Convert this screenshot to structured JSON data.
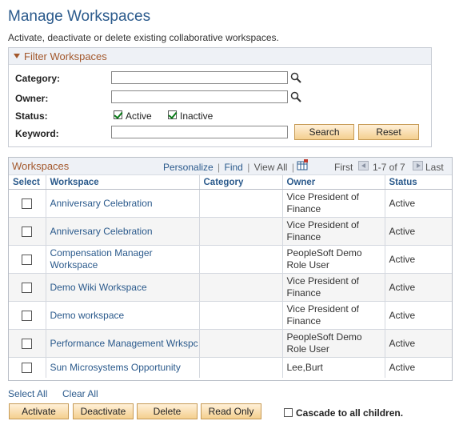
{
  "page": {
    "title": "Manage Workspaces",
    "subtitle": "Activate, deactivate or delete existing collaborative workspaces."
  },
  "filter": {
    "header": "Filter Workspaces",
    "category_label": "Category:",
    "category_value": "",
    "owner_label": "Owner:",
    "owner_value": "",
    "status_label": "Status:",
    "status_active_label": "Active",
    "status_active_checked": true,
    "status_inactive_label": "Inactive",
    "status_inactive_checked": true,
    "keyword_label": "Keyword:",
    "keyword_value": "",
    "search_label": "Search",
    "reset_label": "Reset"
  },
  "grid": {
    "title": "Workspaces",
    "personalize": "Personalize",
    "find": "Find",
    "view_all": "View All",
    "first": "First",
    "range": "1-7 of 7",
    "last": "Last",
    "columns": [
      "Select",
      "Workspace",
      "Category",
      "Owner",
      "Status"
    ],
    "rows": [
      {
        "workspace": "Anniversary Celebration",
        "category": "",
        "owner": "Vice President of Finance",
        "status": "Active"
      },
      {
        "workspace": "Anniversary Celebration",
        "category": "",
        "owner": "Vice President of Finance",
        "status": "Active"
      },
      {
        "workspace": "Compensation Manager Workspace",
        "category": "",
        "owner": "PeopleSoft Demo Role User",
        "status": "Active"
      },
      {
        "workspace": "Demo Wiki Workspace",
        "category": "",
        "owner": "Vice President of Finance",
        "status": "Active"
      },
      {
        "workspace": "Demo workspace",
        "category": "",
        "owner": "Vice President of Finance",
        "status": "Active"
      },
      {
        "workspace": "Performance Management Wrkspc",
        "category": "",
        "owner": "PeopleSoft Demo Role User",
        "status": "Active"
      },
      {
        "workspace": "Sun Microsystems Opportunity",
        "category": "",
        "owner": "Lee,Burt",
        "status": "Active"
      }
    ]
  },
  "bottom": {
    "select_all": "Select All",
    "clear_all": "Clear All",
    "activate": "Activate",
    "deactivate": "Deactivate",
    "delete": "Delete",
    "read_only": "Read Only",
    "cascade_label": "Cascade to all children.",
    "cascade_checked": false
  },
  "icons": {
    "lookup": "magnifier-icon",
    "grid_download": "grid-download-icon",
    "prev": "arrow-left-icon",
    "next": "arrow-right-icon"
  },
  "colors": {
    "title": "#2b5a8c",
    "section_header": "#a3582c",
    "button_face": "#f4cf8f",
    "link": "#2b5a8c"
  }
}
